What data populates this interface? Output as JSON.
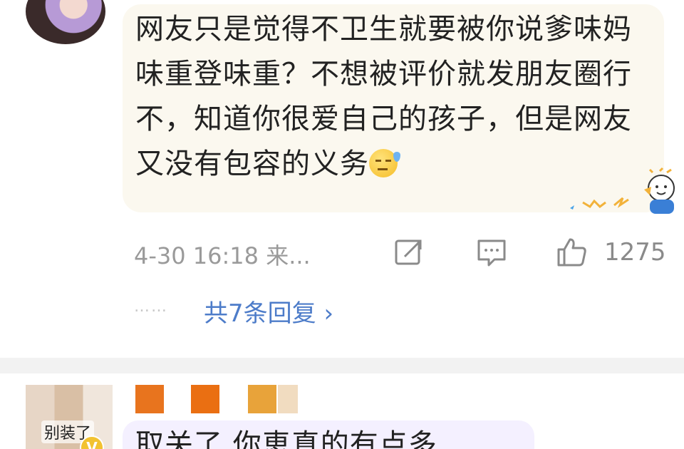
{
  "comment": {
    "text": "网友只是觉得不卫生就要被你说爹味妈味重登味重？不想被评价就发朋友圈行不，知道你很爱自己的孩子，但是网友又没有包容的义务",
    "time": "4-30 16:18 来...",
    "like_count": "1275"
  },
  "replies": {
    "dots": "……",
    "label": "共7条回复 ›"
  },
  "next_comment": {
    "avatar_label": "别装了",
    "vip_letter": "V",
    "text": "取关了 你恵真的有点多"
  },
  "icons": {
    "share": "share-icon",
    "comment": "comment-icon",
    "like": "thumbs-up-icon"
  },
  "colors": {
    "bubble": "#fbf8ef",
    "link": "#4d7cc9",
    "meta": "#9a9a9a"
  }
}
